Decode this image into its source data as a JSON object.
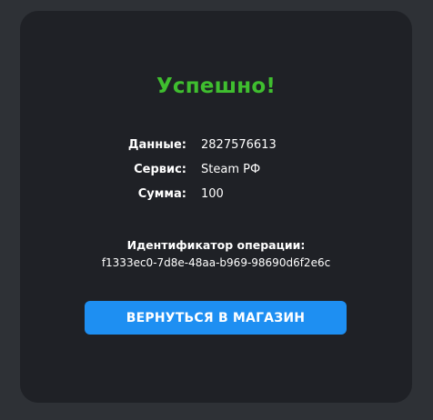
{
  "status": {
    "title": "Успешно!"
  },
  "details": [
    {
      "label": "Данные:",
      "value": "2827576613"
    },
    {
      "label": "Сервис:",
      "value": "Steam РФ"
    },
    {
      "label": "Сумма:",
      "value": "100"
    }
  ],
  "operation": {
    "label": "Идентификатор операции:",
    "id": "f1333ec0-7d8e-48aa-b969-98690d6f2e6c"
  },
  "actions": {
    "back_to_store": "ВЕРНУТЬСЯ В МАГАЗИН"
  },
  "colors": {
    "background": "#2e3136",
    "card": "#1f2126",
    "success": "#3fbe2f",
    "button": "#1e8ff2",
    "text": "#ffffff"
  }
}
